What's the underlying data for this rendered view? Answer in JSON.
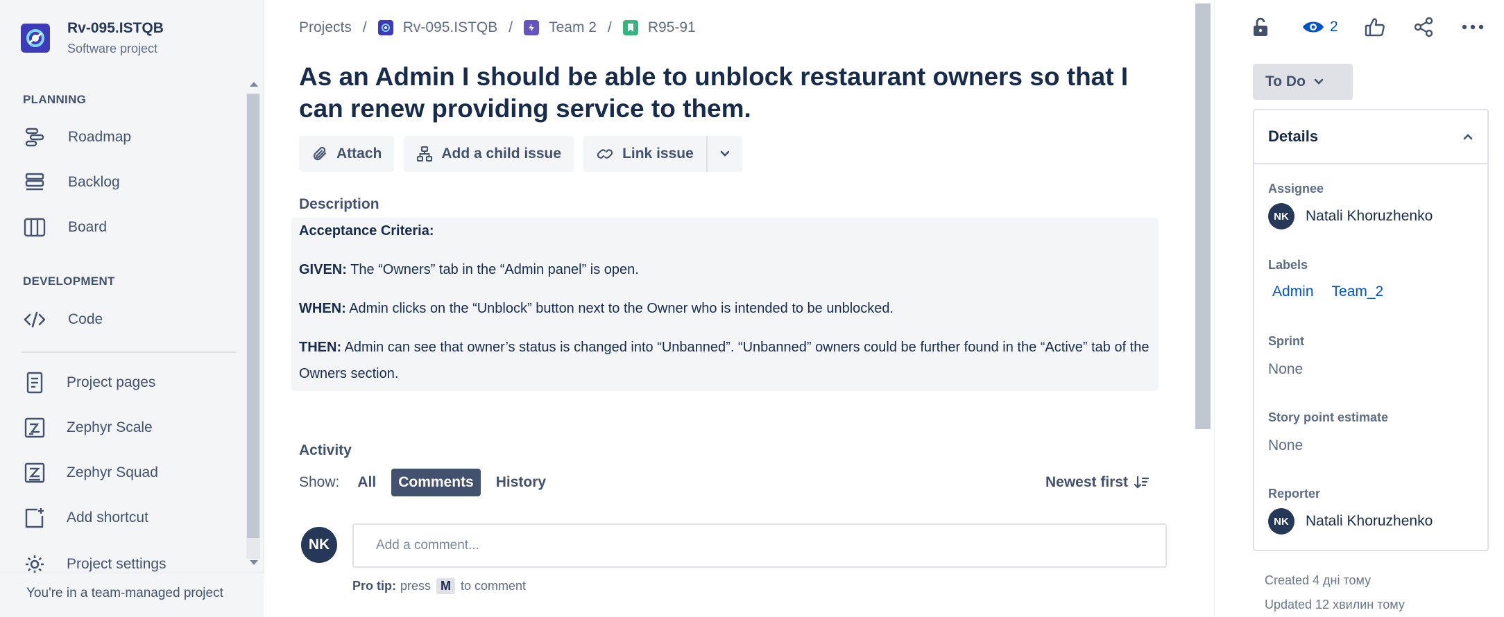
{
  "project": {
    "name": "Rv-095.ISTQB",
    "type": "Software project"
  },
  "sidebar": {
    "planning_label": "PLANNING",
    "development_label": "DEVELOPMENT",
    "items": [
      {
        "label": "Roadmap",
        "icon": "roadmap-icon"
      },
      {
        "label": "Backlog",
        "icon": "backlog-icon"
      },
      {
        "label": "Board",
        "icon": "board-icon"
      },
      {
        "label": "Code",
        "icon": "code-icon"
      },
      {
        "label": "Project pages",
        "icon": "page-icon"
      },
      {
        "label": "Zephyr Scale",
        "icon": "zephyr-scale-icon"
      },
      {
        "label": "Zephyr Squad",
        "icon": "zephyr-squad-icon"
      },
      {
        "label": "Add shortcut",
        "icon": "add-shortcut-icon"
      },
      {
        "label": "Project settings",
        "icon": "gear-icon"
      }
    ],
    "footer": "You're in a team-managed project"
  },
  "breadcrumb": [
    "Projects",
    "Rv-095.ISTQB",
    "Team 2",
    "R95-91"
  ],
  "issue": {
    "title": "As an Admin I should be able to unblock restaurant owners so that I can renew providing service to them."
  },
  "toolbar": {
    "attach": "Attach",
    "add_child": "Add a child issue",
    "link_issue": "Link issue"
  },
  "description": {
    "label": "Description",
    "heading": "Acceptance Criteria:",
    "given_key": "GIVEN:",
    "given_text": " The “Owners” tab in the “Admin panel” is open.",
    "when_key": "WHEN:",
    "when_text": " Admin clicks on the “Unblock” button next to the Owner who is intended to be unblocked.",
    "then_key": "THEN:",
    "then_text": " Admin can see that owner’s status is changed into “Unbanned”. “Unbanned” owners could be further found in the “Active” tab of the Owners section."
  },
  "activity": {
    "label": "Activity",
    "show": "Show:",
    "filters": [
      "All",
      "Comments",
      "History"
    ],
    "active_filter": "Comments",
    "sort": "Newest first",
    "avatar_initials": "NK",
    "comment_placeholder": "Add a comment...",
    "protip_label": "Pro tip:",
    "protip_press": "press",
    "protip_key": "M",
    "protip_rest": "to comment"
  },
  "right": {
    "watch_count": "2",
    "status": "To Do",
    "details_title": "Details",
    "assignee_label": "Assignee",
    "assignee_initials": "NK",
    "assignee_name": "Natali Khoruzhenko",
    "labels_label": "Labels",
    "labels": [
      "Admin",
      "Team_2"
    ],
    "sprint_label": "Sprint",
    "sprint_value": "None",
    "story_points_label": "Story point estimate",
    "story_points_value": "None",
    "reporter_label": "Reporter",
    "reporter_initials": "NK",
    "reporter_name": "Natali Khoruzhenko",
    "created": "Created 4 дні тому",
    "updated": "Updated 12 хвилин тому"
  },
  "colors": {
    "accent": "#0052cc",
    "sidebar_bg": "#f4f5f7",
    "text": "#172b4d",
    "project_avatar": "#3e3bb8",
    "story_green": "#36b37e",
    "epic_purple": "#6554c0"
  }
}
